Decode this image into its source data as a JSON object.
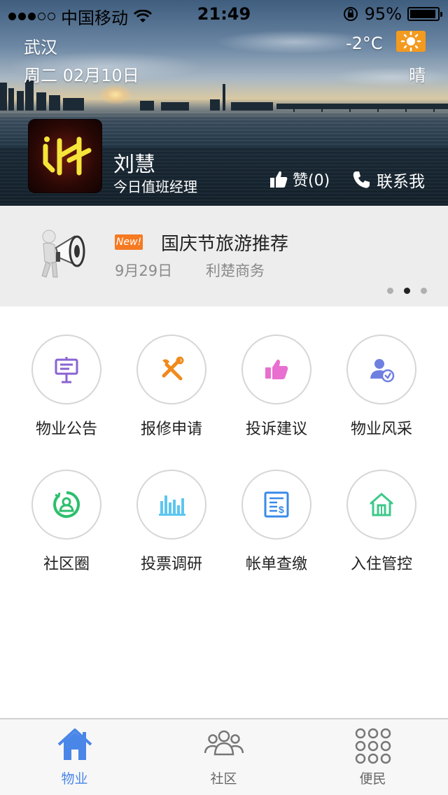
{
  "status_bar": {
    "carrier": "中国移动",
    "time": "21:49",
    "battery": "95%",
    "battery_level": 0.95
  },
  "weather": {
    "city": "武汉",
    "date": "周二 02月10日",
    "temperature": "-2°C",
    "condition": "晴",
    "icon": "sun-icon",
    "badge_color": "#f39a1f"
  },
  "manager": {
    "name": "刘慧",
    "role": "今日值班经理",
    "like_label": "赞(0)",
    "contact_label": "联系我"
  },
  "notice": {
    "badge": "New!",
    "title": "国庆节旅游推荐",
    "date": "9月29日",
    "source": "利楚商务",
    "pages": 3,
    "active_page": 2
  },
  "services": [
    {
      "label": "物业公告",
      "icon": "announcement-board-icon",
      "color": "#8a63d2"
    },
    {
      "label": "报修申请",
      "icon": "repair-tools-icon",
      "color": "#f08a1c"
    },
    {
      "label": "投诉建议",
      "icon": "thumbs-up-icon",
      "color": "#e86fd0"
    },
    {
      "label": "物业风采",
      "icon": "staff-verified-icon",
      "color": "#6f7fe0"
    },
    {
      "label": "社区圈",
      "icon": "community-circle-icon",
      "color": "#2dbf6e"
    },
    {
      "label": "投票调研",
      "icon": "bar-chart-icon",
      "color": "#5cc6f0"
    },
    {
      "label": "帐单查缴",
      "icon": "bill-icon",
      "color": "#3a8be8"
    },
    {
      "label": "入住管控",
      "icon": "house-icon",
      "color": "#3ec88a"
    }
  ],
  "tabbar": {
    "tabs": [
      {
        "label": "物业",
        "icon": "home-icon",
        "active": true
      },
      {
        "label": "社区",
        "icon": "people-icon",
        "active": false
      },
      {
        "label": "便民",
        "icon": "grid-dots-icon",
        "active": false
      }
    ],
    "active_color": "#4a86e8"
  }
}
